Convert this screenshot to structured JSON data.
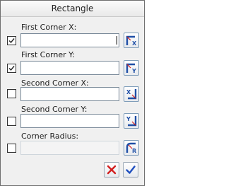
{
  "window": {
    "title": "Rectangle"
  },
  "fields": [
    {
      "label": "First Corner X:",
      "checked": true,
      "value": "",
      "enabled": true,
      "icon": "pick-x-icon"
    },
    {
      "label": "First Corner Y:",
      "checked": true,
      "value": "",
      "enabled": true,
      "icon": "pick-y-icon"
    },
    {
      "label": "Second Corner X:",
      "checked": false,
      "value": "",
      "enabled": true,
      "icon": "pick-second-x-icon"
    },
    {
      "label": "Second Corner Y:",
      "checked": false,
      "value": "",
      "enabled": true,
      "icon": "pick-second-y-icon"
    },
    {
      "label": "Corner Radius:",
      "checked": false,
      "value": "",
      "enabled": false,
      "icon": "pick-radius-icon"
    }
  ],
  "buttons": {
    "cancel_icon": "cancel-x-icon",
    "ok_icon": "ok-check-icon"
  },
  "colors": {
    "icon_blue": "#1f4fa6",
    "icon_red": "#d21f1f",
    "check_blue": "#1f4fbf"
  }
}
